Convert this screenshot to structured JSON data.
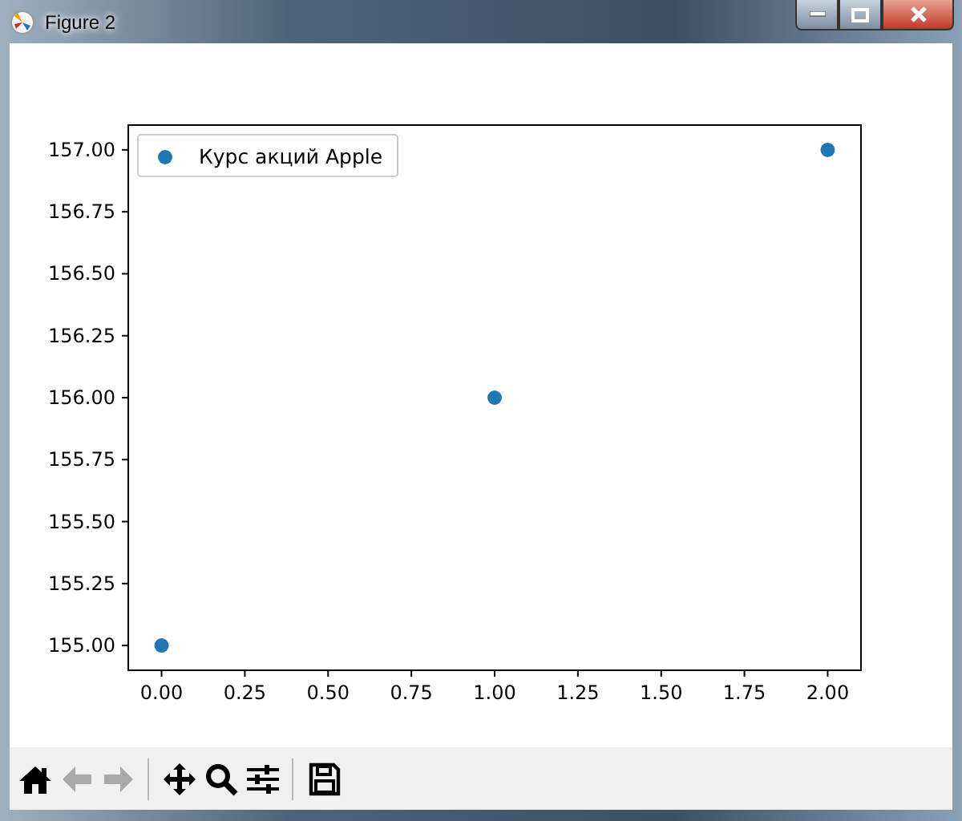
{
  "window": {
    "title": "Figure 2"
  },
  "figure": {
    "chart_data": {
      "type": "scatter",
      "x": [
        0,
        1,
        2
      ],
      "series": [
        {
          "name": "Курс акций Apple",
          "color": "#1f77b4",
          "values": [
            155,
            156,
            157
          ]
        }
      ],
      "xlim": [
        -0.1,
        2.1
      ],
      "ylim": [
        154.9,
        157.1
      ],
      "xticks": [
        {
          "value": 0,
          "label": "0.00"
        },
        {
          "value": 0.25,
          "label": "0.25"
        },
        {
          "value": 0.5,
          "label": "0.50"
        },
        {
          "value": 0.75,
          "label": "0.75"
        },
        {
          "value": 1,
          "label": "1.00"
        },
        {
          "value": 1.25,
          "label": "1.25"
        },
        {
          "value": 1.5,
          "label": "1.50"
        },
        {
          "value": 1.75,
          "label": "1.75"
        },
        {
          "value": 2,
          "label": "2.00"
        }
      ],
      "yticks": [
        {
          "value": 155,
          "label": "155.00"
        },
        {
          "value": 155.25,
          "label": "155.25"
        },
        {
          "value": 155.5,
          "label": "155.50"
        },
        {
          "value": 155.75,
          "label": "155.75"
        },
        {
          "value": 156,
          "label": "156.00"
        },
        {
          "value": 156.25,
          "label": "156.25"
        },
        {
          "value": 156.5,
          "label": "156.50"
        },
        {
          "value": 156.75,
          "label": "156.75"
        },
        {
          "value": 157,
          "label": "157.00"
        }
      ]
    }
  },
  "toolbar": [
    {
      "kind": "home",
      "disabled": false
    },
    {
      "kind": "back",
      "disabled": true
    },
    {
      "kind": "forward",
      "disabled": true
    },
    {
      "kind": "separator"
    },
    {
      "kind": "pan",
      "disabled": false
    },
    {
      "kind": "zoom",
      "disabled": false
    },
    {
      "kind": "configure",
      "disabled": false
    },
    {
      "kind": "separator"
    },
    {
      "kind": "save",
      "disabled": false
    }
  ]
}
